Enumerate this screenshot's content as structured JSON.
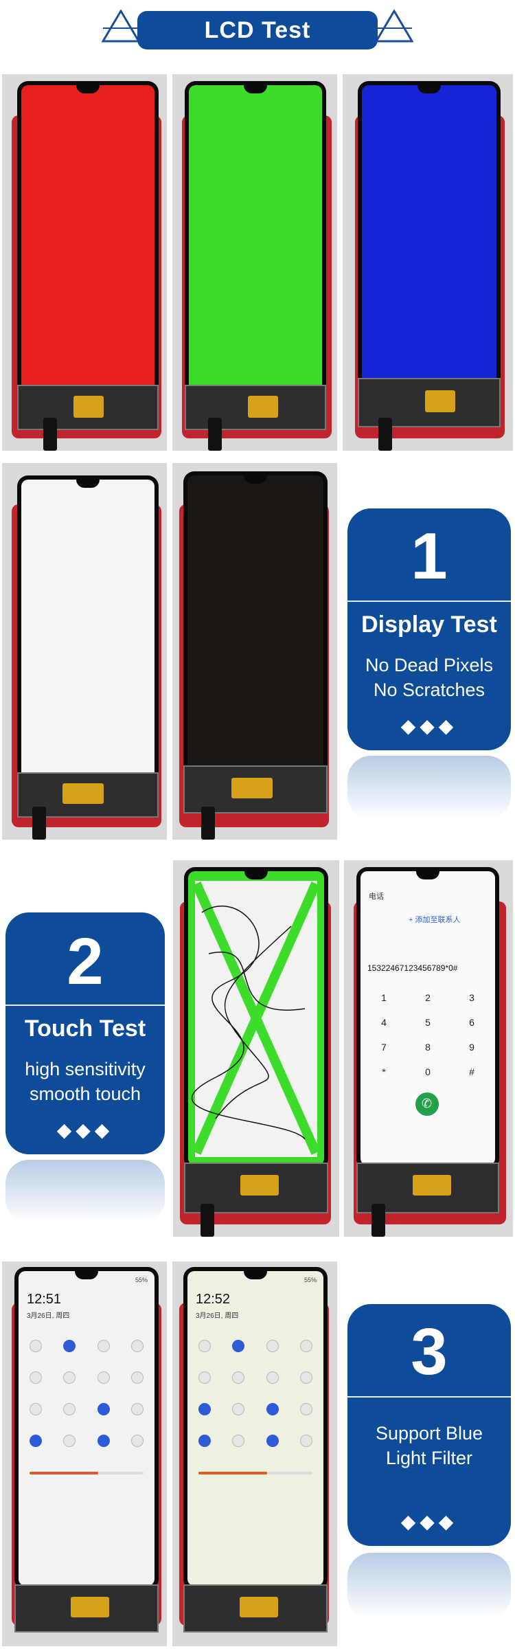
{
  "header": {
    "title": "LCD Test"
  },
  "cards": [
    {
      "number": "1",
      "title": "Display Test",
      "lines": [
        "No Dead Pixels",
        "No Scratches"
      ],
      "diamonds": "◆◆◆"
    },
    {
      "number": "2",
      "title": "Touch Test",
      "lines": [
        "high sensitivity",
        "smooth touch"
      ],
      "diamonds": "◆◆◆"
    },
    {
      "number": "3",
      "title": "",
      "lines": [
        "Support Blue",
        "Light Filter"
      ],
      "diamonds": "◆◆◆"
    }
  ],
  "dialer": {
    "header": "电话",
    "add_contact": "+ 添加至联系人",
    "number": "15322467123456789*0#",
    "keys": [
      "1",
      "2",
      "3",
      "4",
      "5",
      "6",
      "7",
      "8",
      "9",
      "*",
      "0",
      "#"
    ]
  },
  "quick_panel_1": {
    "time": "12:51",
    "date": "3月26日, 周四",
    "battery": "55%"
  },
  "quick_panel_2": {
    "time": "12:52",
    "date": "3月26日, 周四",
    "battery": "55%"
  },
  "colors": {
    "brand": "#0e4c9a",
    "red_test": "#e81f1f",
    "green_test": "#3ddc2a",
    "blue_test": "#1525d6",
    "white_test": "#f4f4f4",
    "black_test": "#1a1614"
  }
}
